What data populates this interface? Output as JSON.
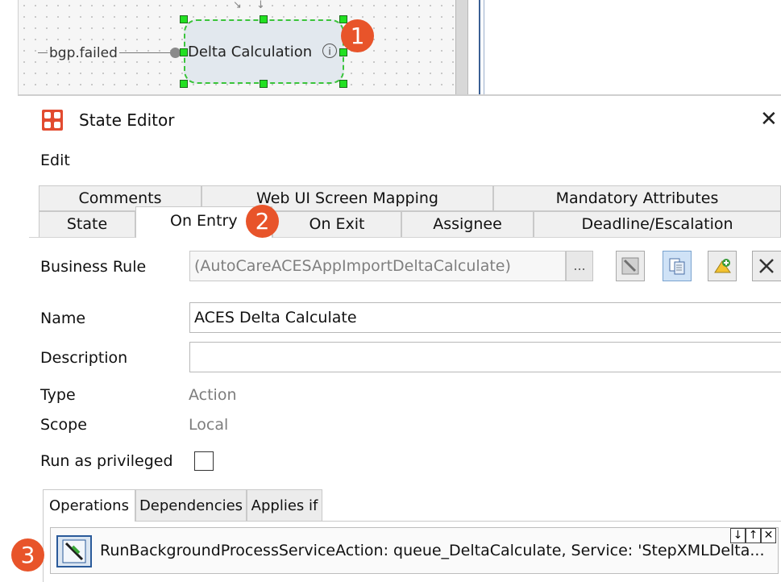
{
  "canvas": {
    "edge_label": "bgp.failed",
    "node_label": "Delta Calculation",
    "node_info_glyph": "i"
  },
  "callouts": [
    "1",
    "2",
    "3"
  ],
  "dialog": {
    "title": "State Editor",
    "close_glyph": "✕",
    "menu": {
      "edit": "Edit"
    },
    "tabs_row1": [
      "Comments",
      "Web UI Screen Mapping",
      "Mandatory Attributes"
    ],
    "tabs_row2": [
      "State",
      "On Entry",
      "On Exit",
      "Assignee",
      "Deadline/Escalation"
    ],
    "active_tab": "On Entry",
    "business_rule": {
      "label": "Business Rule",
      "value": "(AutoCareACESAppImportDeltaCalculate)",
      "browse_label": "..."
    },
    "name": {
      "label": "Name",
      "value": "ACES Delta Calculate"
    },
    "description": {
      "label": "Description",
      "value": ""
    },
    "type": {
      "label": "Type",
      "value": "Action"
    },
    "scope": {
      "label": "Scope",
      "value": "Local"
    },
    "privileged": {
      "label": "Run as privileged",
      "checked": false
    },
    "subtabs": [
      "Operations",
      "Dependencies",
      "Applies if"
    ],
    "active_subtab": "Operations",
    "operation": {
      "text": "RunBackgroundProcessServiceAction: queue_DeltaCalculate, Service: 'StepXMLDelta...",
      "move_down": "↓",
      "move_up": "↑",
      "remove": "✕"
    },
    "toolbar_icons": [
      "edit-rule-icon",
      "copy-rule-icon",
      "add-rule-icon",
      "delete-rule-icon"
    ]
  },
  "colors": {
    "callout": "#e8542a",
    "node_selection": "#3bc43b",
    "node_fill": "#e2e8ee",
    "brand_icon": "#e24b30"
  }
}
